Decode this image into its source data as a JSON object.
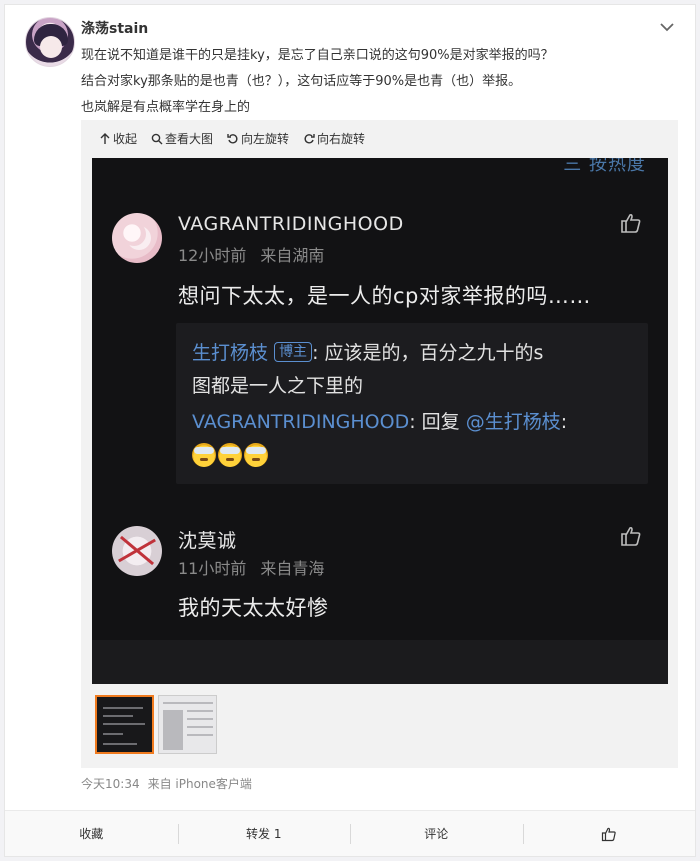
{
  "post": {
    "username": "涤荡stain",
    "lines": [
      "现在说不知道是谁干的只是挂ky，是忘了自己亲口说的这句90%是对家举报的吗？",
      "结合对家ky那条贴的是也青（也？），这句话应等于90%是也青（也）举报。",
      "也岚解是有点概率学在身上的"
    ],
    "time": "今天10:34",
    "source": "来自 iPhone客户端"
  },
  "toolbar": {
    "collapse": "收起",
    "view_large": "查看大图",
    "rotate_left": "向左旋转",
    "rotate_right": "向右旋转"
  },
  "screenshot": {
    "sort_label": "三 按热度",
    "comment1": {
      "name": "VAGRANTRIDINGHOOD",
      "time": "12小时前",
      "location": "来自湖南",
      "body": "想问下太太，是一人的cp对家举报的吗……",
      "reply1_author": "生打杨枝",
      "reply1_badge": "博主",
      "reply1_text": ": 应该是的，百分之九十的s",
      "reply1_text2": "图都是一人之下里的",
      "reply2_author": "VAGRANTRIDINGHOOD",
      "reply2_text": ": 回复 ",
      "reply2_mention": "@生打杨枝",
      "reply2_colon": ":"
    },
    "comment2": {
      "name": "沈莫诚",
      "time": "11小时前",
      "location": "来自青海",
      "body": "我的天太太好惨"
    }
  },
  "actions": {
    "favorite": "收藏",
    "repost": "转发 1",
    "comment": "评论"
  },
  "icons": {
    "chevron": "chevron-down-icon",
    "like": "thumbs-up-icon"
  },
  "colors": {
    "link_blue": "#5b8fd0",
    "thumb_selected": "#f07b1f"
  }
}
